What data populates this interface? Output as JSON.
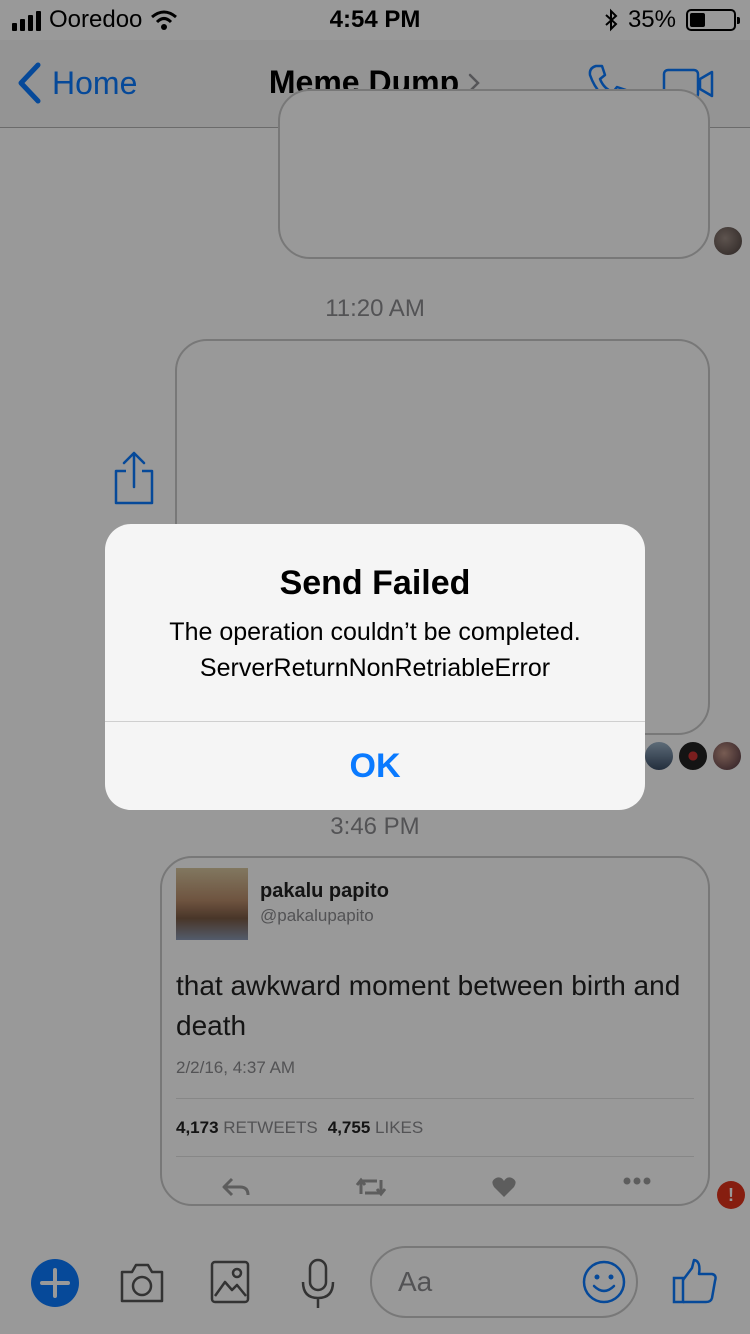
{
  "status_bar": {
    "carrier": "Ooredoo",
    "time": "4:54 PM",
    "battery_percent": "35%",
    "battery_level": 0.35
  },
  "nav": {
    "back_label": "Home",
    "title": "Meme Dump",
    "accent_color": "#0a7aff"
  },
  "chat": {
    "timestamps": [
      "11:20 AM",
      "3:46 PM"
    ],
    "tweet": {
      "name": "pakalu papito",
      "handle": "@pakalupapito",
      "text": "that awkward moment between birth and death",
      "date": "2/2/16, 4:37 AM",
      "retweets": "4,173",
      "retweets_label": "RETWEETS",
      "likes": "4,755",
      "likes_label": "LIKES"
    },
    "error_badge": "!"
  },
  "toolbar": {
    "compose_placeholder": "Aa"
  },
  "alert": {
    "title": "Send Failed",
    "message_line1": "The operation couldn’t be completed.",
    "message_line2": "ServerReturnNonRetriableError",
    "button_label": "OK"
  }
}
